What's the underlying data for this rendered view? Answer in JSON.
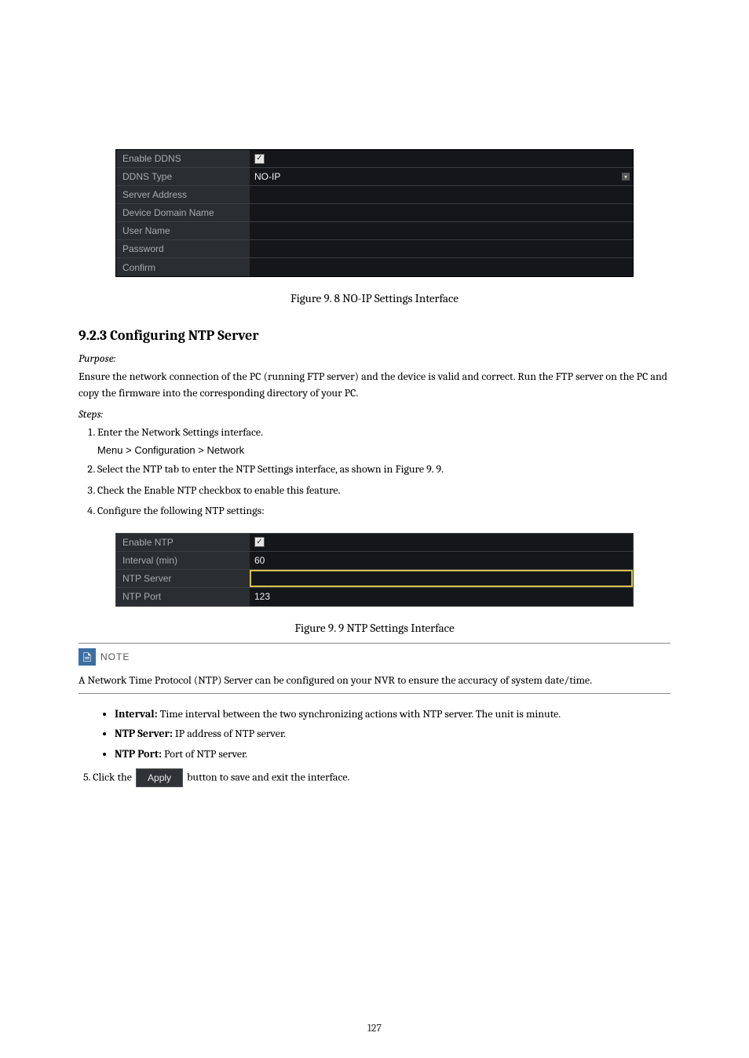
{
  "ddns_panel": {
    "rows": [
      {
        "label": "Enable DDNS",
        "value_is_checkbox": true,
        "checked": true
      },
      {
        "label": "DDNS Type",
        "value": "NO-IP",
        "dropdown": true
      },
      {
        "label": "Server Address",
        "value": ""
      },
      {
        "label": "Device Domain Name",
        "value": ""
      },
      {
        "label": "User Name",
        "value": ""
      },
      {
        "label": "Password",
        "value": ""
      },
      {
        "label": "Confirm",
        "value": ""
      }
    ]
  },
  "figure1_caption": "Figure 9. 8  NO-IP Settings Interface",
  "section_heading": "9.2.3 Configuring NTP Server",
  "purpose_label": "Purpose:",
  "purpose_text": "Ensure the network connection of the PC (running FTP server) and the device is valid and correct. Run the FTP server on the PC and copy the firmware into the corresponding directory of your PC.",
  "steps_label": "Steps:",
  "steps": [
    "Enter the Network Settings interface.",
    "Select the NTP tab to enter the NTP Settings interface, as shown in Figure 9. 9.",
    "Check the Enable NTP checkbox to enable this feature.",
    "Configure the following NTP settings:"
  ],
  "menu_path": "Menu > Configuration > Network",
  "ntp_panel": {
    "rows": [
      {
        "label": "Enable NTP",
        "value_is_checkbox": true,
        "checked": true
      },
      {
        "label": "Interval (min)",
        "value": "60"
      },
      {
        "label": "NTP Server",
        "value": "",
        "highlight": true
      },
      {
        "label": "NTP Port",
        "value": "123"
      }
    ]
  },
  "figure2_caption": "Figure 9. 9  NTP Settings Interface",
  "note_label": "NOTE",
  "note_text": "A Network Time Protocol (NTP) Server can be configured on your NVR to ensure the accuracy of system date/time.",
  "bullets": [
    {
      "label": "Interval:",
      "text": " Time interval between the two synchronizing actions with NTP server. The unit is minute."
    },
    {
      "label": "NTP Server:",
      "text": " IP address of NTP server."
    },
    {
      "label": "NTP Port:",
      "text": " Port of NTP server."
    }
  ],
  "step5_prefix": "5.    Click the ",
  "apply_label": "Apply",
  "step5_suffix": " button to save and exit the interface.",
  "page_number": "127"
}
